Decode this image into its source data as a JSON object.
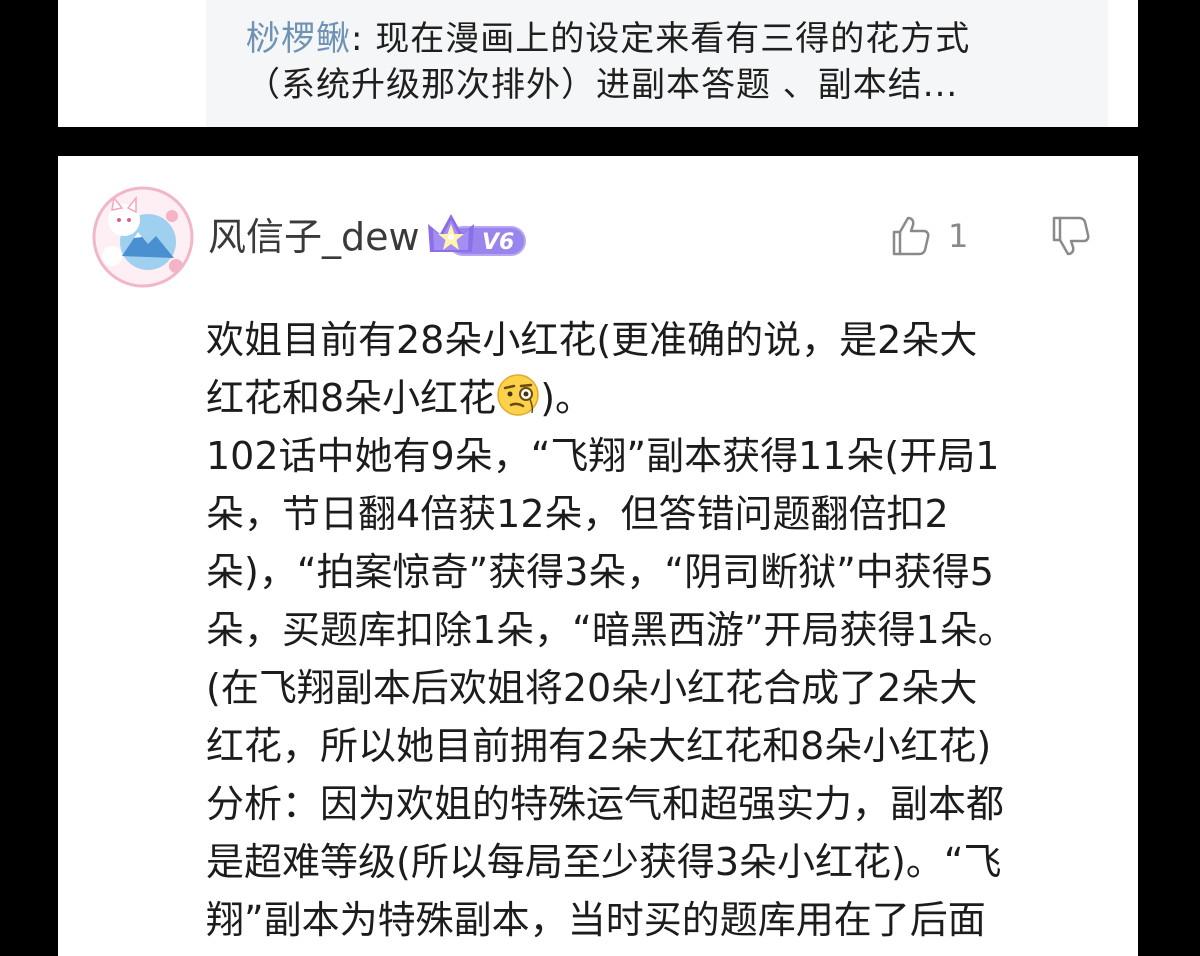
{
  "reply_preview": {
    "author": "桫椤鳅",
    "separator": ": ",
    "line1": "现在漫画上的设定来看有三得的花方式",
    "line2": "（系统升级那次排外）进副本答题 、副本结..."
  },
  "comment": {
    "username": "风信子_dew",
    "level": "V6",
    "like_count": "1",
    "lines": [
      "欢姐目前有28朵小红花(更准确的说，是2朵大",
      "红花和8朵小红花",
      ")。",
      "102话中她有9朵，“飞翔”副本获得11朵(开局1",
      "朵，节日翻4倍获12朵，但答错问题翻倍扣2",
      "朵)，“拍案惊奇”获得3朵，“阴司断狱”中获得5",
      "朵，买题库扣除1朵，“暗黑西游”开局获得1朵。",
      "(在飞翔副本后欢姐将20朵小红花合成了2朵大",
      "红花，所以她目前拥有2朵大红花和8朵小红花)",
      "分析：因为欢姐的特殊运气和超强实力，副本都",
      "是超难等级(所以每局至少获得3朵小红花)。“飞",
      "翔”副本为特殊副本，当时买的题库用在了后面"
    ]
  },
  "colors": {
    "background": "#000000",
    "card": "#ffffff",
    "reply_box": "#f5f6f7",
    "reply_author": "#6f93b5",
    "badge_purple": "#8b6ee8"
  },
  "icons": {
    "like": "thumbs-up-icon",
    "dislike": "thumbs-down-icon",
    "level": "crown-star-icon",
    "emoji": "monocle-face-emoji"
  }
}
